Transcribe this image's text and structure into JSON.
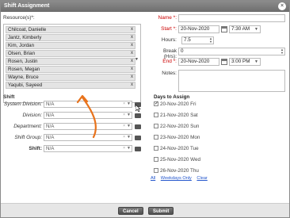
{
  "dialog": {
    "title": "Shift Assignment",
    "close_glyph": "×"
  },
  "resources": {
    "label": "Resource(s)*:",
    "items": [
      "Chilcoat, Danielle",
      "Jantz, Kimberly",
      "Kim, Jordan",
      "Olsen, Brian",
      "Rosen, Justin",
      "Rosen, Megan",
      "Wayne, Bruce",
      "Yaqubi, Sayeed"
    ],
    "remove_glyph": "x",
    "dropdown_glyph": "▼"
  },
  "shift": {
    "header": "Shift",
    "fields": [
      {
        "label": "System Division:",
        "value": "N/A"
      },
      {
        "label": "Division:",
        "value": "N/A"
      },
      {
        "label": "Department:",
        "value": "N/A"
      },
      {
        "label": "Shift Group:",
        "value": "N/A"
      },
      {
        "label": "Shift:",
        "value": "N/A"
      }
    ]
  },
  "schedule": {
    "name_label": "Name *:",
    "name_value": "",
    "start_label": "Start *:",
    "start_date": "20-Nov-2020",
    "start_time": "7:30 AM",
    "hours_label": "Hours:",
    "hours_value": "7.5",
    "break_label": "Break (Hrs):",
    "break_value": "0",
    "end_label": "End *:",
    "end_date": "20-Nov-2020",
    "end_time": "3:00 PM",
    "notes_label": "Notes:",
    "notes_value": ""
  },
  "days": {
    "header": "Days to Assign",
    "items": [
      {
        "label": "20-Nov-2020 Fri",
        "checked": true
      },
      {
        "label": "21-Nov-2020 Sat",
        "checked": false
      },
      {
        "label": "22-Nov-2020 Sun",
        "checked": false
      },
      {
        "label": "23-Nov-2020 Mon",
        "checked": false
      },
      {
        "label": "24-Nov-2020 Tue",
        "checked": false
      },
      {
        "label": "25-Nov-2020 Wed",
        "checked": false
      },
      {
        "label": "26-Nov-2020 Thu",
        "checked": false
      }
    ],
    "links": {
      "all": "All",
      "weekdays": "Weekdays Only",
      "clear": "Clear"
    }
  },
  "footer": {
    "cancel_label": "Cancel",
    "submit_label": "Submit"
  },
  "colors": {
    "annotation_arrow": "#e8731c",
    "required_label": "#cc0000",
    "link": "#2255cc"
  }
}
